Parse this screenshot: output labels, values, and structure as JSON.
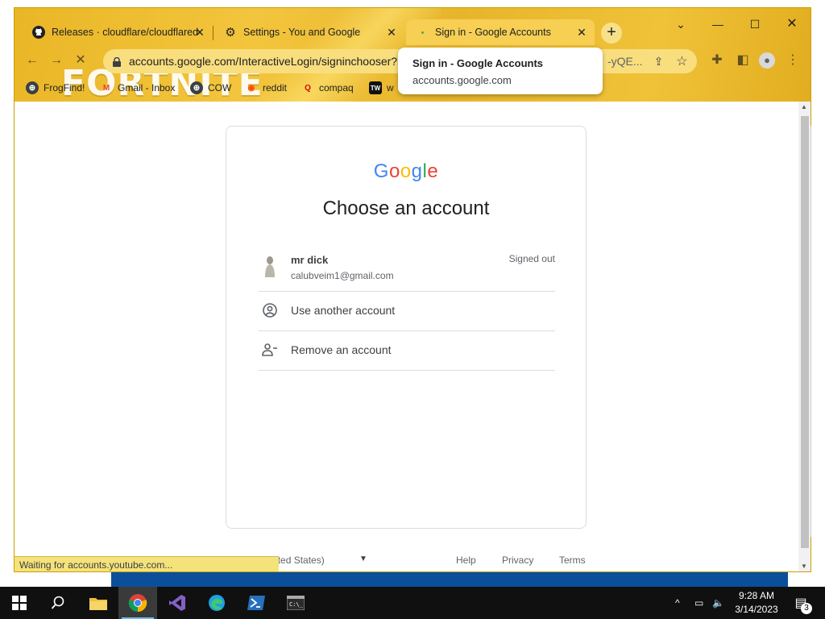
{
  "tabs": [
    {
      "title": "Releases · cloudflare/cloudflared",
      "icon": "github-icon"
    },
    {
      "title": "Settings - You and Google",
      "icon": "gear-icon"
    },
    {
      "title": "Sign in - Google Accounts",
      "icon": "loading-dot-icon"
    }
  ],
  "omnibox": {
    "url": "accounts.google.com/InteractiveLogin/signinchooser?",
    "url_tail": "-yQE..."
  },
  "bookmarks": [
    {
      "label": "FrogFind!"
    },
    {
      "label": "Gmail - Inbox"
    },
    {
      "label": "COW"
    },
    {
      "label": "reddit"
    },
    {
      "label": "compaq"
    },
    {
      "label": "w"
    }
  ],
  "theme_overlay_text": "FORTNITE",
  "tooltip": {
    "title": "Sign in - Google Accounts",
    "domain": "accounts.google.com"
  },
  "page": {
    "logo_letters": [
      "G",
      "o",
      "o",
      "g",
      "l",
      "e"
    ],
    "logo_colors": [
      "#4285F4",
      "#EA4335",
      "#FBBC05",
      "#4285F4",
      "#34A853",
      "#EA4335"
    ],
    "heading": "Choose an account",
    "account": {
      "name": "mr dick",
      "email": "calubveim1@gmail.com",
      "status": "Signed out"
    },
    "use_another": "Use another account",
    "remove": "Remove an account",
    "footer": {
      "language": "English (United States)",
      "help": "Help",
      "privacy": "Privacy",
      "terms": "Terms"
    }
  },
  "statusbar": "Waiting for accounts.youtube.com...",
  "taskbar": {
    "time": "9:28 AM",
    "date": "3/14/2023",
    "notification_count": "3"
  },
  "colors": {
    "chrome_theme": "#f0c238",
    "accent_blue": "#1a73e8",
    "taskbar": "#101010"
  }
}
